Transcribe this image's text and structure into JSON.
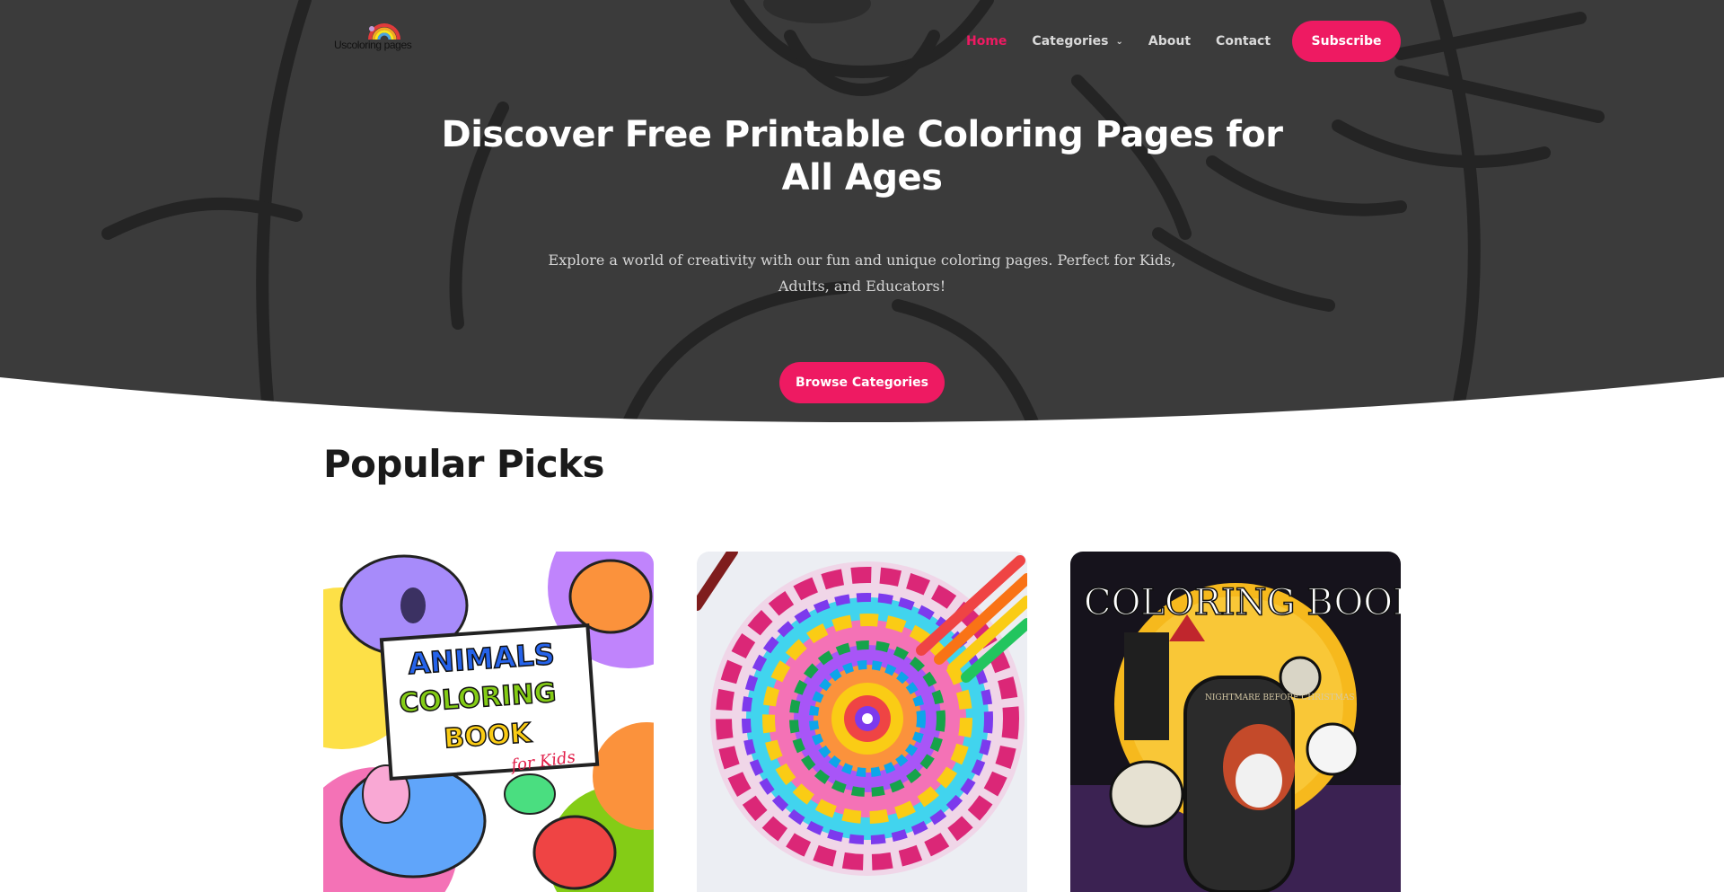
{
  "header": {
    "logo_text": "Uscoloring pages",
    "nav": [
      {
        "label": "Home",
        "active": true
      },
      {
        "label": "Categories",
        "has_dropdown": true
      },
      {
        "label": "About"
      },
      {
        "label": "Contact"
      }
    ],
    "subscribe_label": "Subscribe"
  },
  "hero": {
    "title": "Discover Free Printable Coloring Pages for All Ages",
    "subtitle": "Explore a world of creativity with our fun and unique coloring pages. Perfect for Kids, Adults, and Educators!",
    "cta_label": "Browse Categories"
  },
  "popular": {
    "title": "Popular Picks",
    "cards": [
      {
        "image_text": [
          "ANIMALS",
          "COLORING",
          "BOOK",
          "for Kids"
        ]
      },
      {
        "image_text": []
      },
      {
        "image_text": [
          "COLORING BOOK",
          "NIGHTMARE BEFORE CHRISTMAS"
        ]
      }
    ]
  },
  "colors": {
    "accent": "#ee1a62",
    "hero_bg": "#3b3b3b",
    "nav_text": "#d9d9d9"
  }
}
